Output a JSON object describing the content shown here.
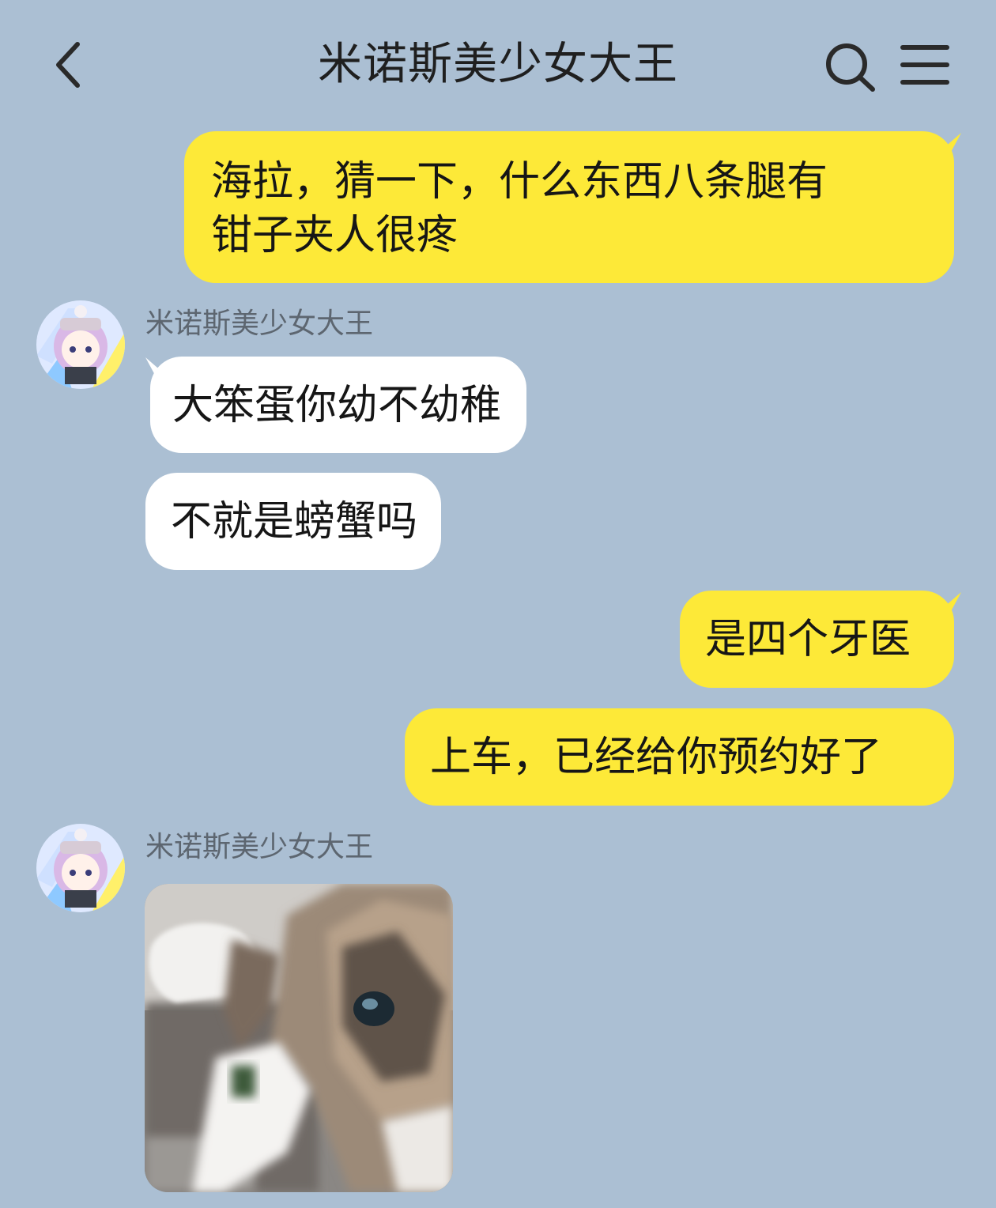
{
  "header": {
    "title": "米诺斯美少女大王",
    "back_icon": "chevron-left-icon",
    "search_icon": "search-icon",
    "menu_icon": "menu-icon"
  },
  "colors": {
    "background": "#abbfd3",
    "my_bubble": "#fde938",
    "their_bubble": "#ffffff"
  },
  "messages": [
    {
      "from": "me",
      "lines": [
        "海拉，猜一下，什么东西八条腿有",
        "钳子夹人很疼"
      ]
    },
    {
      "from": "them",
      "sender": "米诺斯美少女大王",
      "text": "大笨蛋你幼不幼稚"
    },
    {
      "from": "them",
      "text": "不就是螃蟹吗"
    },
    {
      "from": "me",
      "text": "是四个牙医"
    },
    {
      "from": "me",
      "text": "上车，已经给你预约好了"
    },
    {
      "from": "them",
      "sender": "米诺斯美少女大王",
      "image": "cat-photo"
    }
  ]
}
